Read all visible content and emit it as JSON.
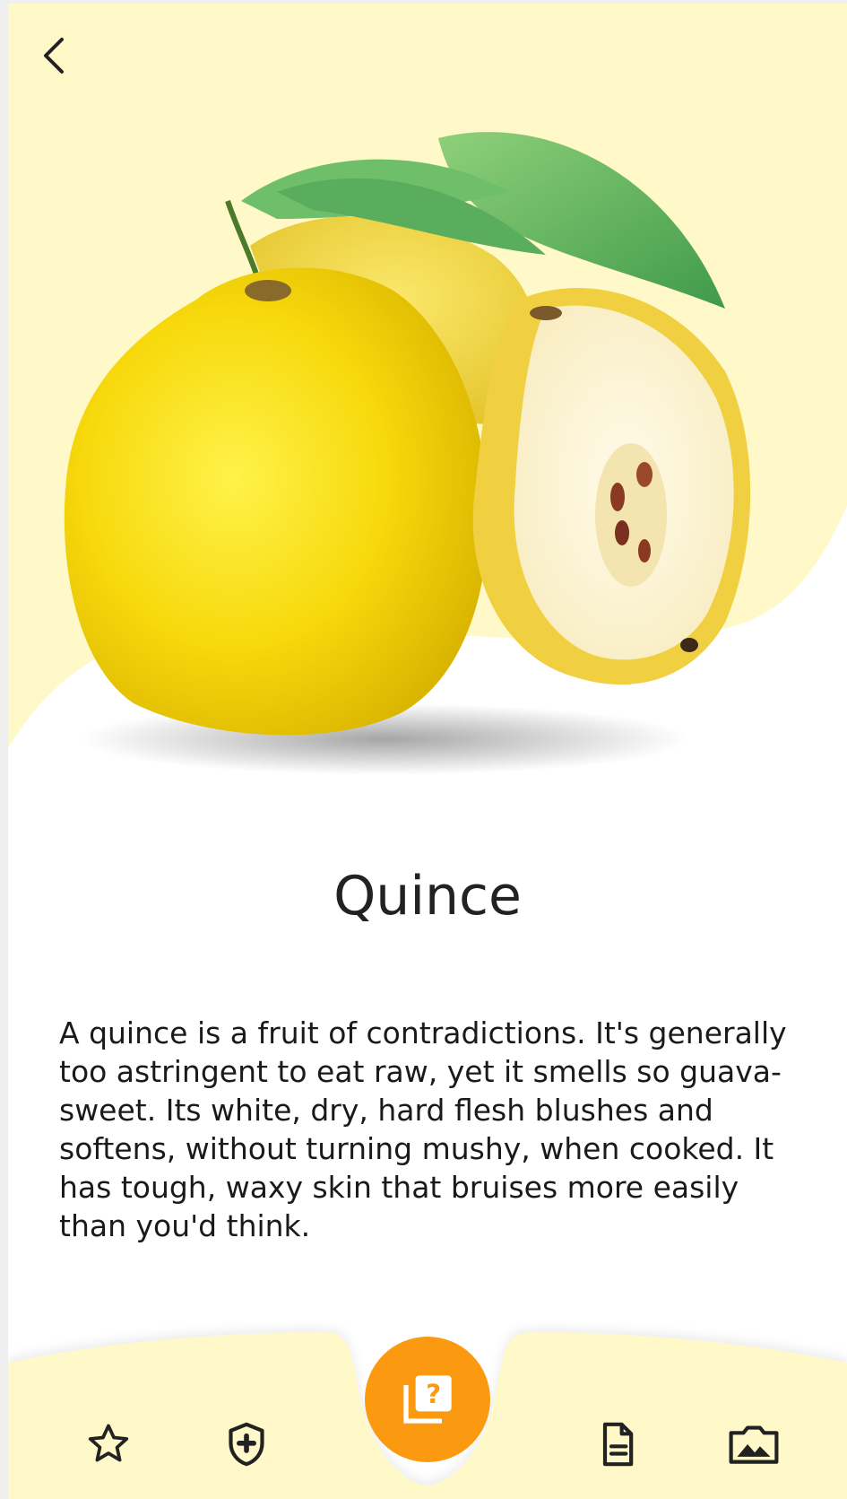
{
  "colors": {
    "hero_background": "#fff8c8",
    "bottom_bar": "#fff8c8",
    "accent": "#fb9a10",
    "text": "#1a1a1a"
  },
  "header": {
    "back_icon": "chevron-left-icon"
  },
  "fruit": {
    "name": "Quince",
    "description": "A quince is a fruit of contradictions. It's generally too astringent to eat raw, yet it smells so guava-sweet. Its white, dry, hard flesh blushes and softens, without turning mushy, when cooked. It has tough, waxy skin that bruises more easily than you'd think."
  },
  "bottom_nav": {
    "items": [
      {
        "icon": "star-outline-icon"
      },
      {
        "icon": "shield-plus-icon"
      },
      {
        "icon": "quiz-cards-icon",
        "center": true
      },
      {
        "icon": "document-icon"
      },
      {
        "icon": "image-icon"
      }
    ]
  }
}
